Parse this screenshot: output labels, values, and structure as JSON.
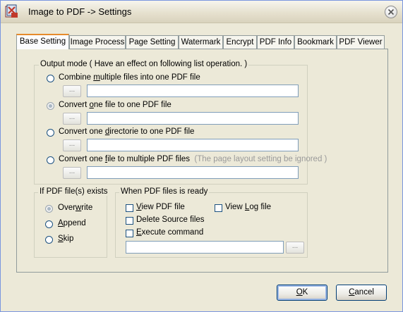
{
  "window": {
    "title": "Image to PDF -> Settings"
  },
  "tabs": [
    {
      "label": "Base Setting",
      "active": true
    },
    {
      "label": "Image Process"
    },
    {
      "label": "Page Setting"
    },
    {
      "label": "Watermark"
    },
    {
      "label": "Encrypt"
    },
    {
      "label": "PDF Info"
    },
    {
      "label": "Bookmark"
    },
    {
      "label": "PDF Viewer"
    }
  ],
  "output_mode": {
    "legend": "Output mode  ( Have an  effect on following list operation. )",
    "options": [
      {
        "pre": "Combine ",
        "key": "m",
        "post": "ultiple files into one PDF file",
        "checked": false,
        "path": ""
      },
      {
        "pre": "Convert ",
        "key": "o",
        "post": "ne file to one PDF file",
        "checked": true,
        "path": ""
      },
      {
        "pre": "Convert one ",
        "key": "d",
        "post": "irectorie to one PDF file",
        "checked": false,
        "path": ""
      },
      {
        "pre": "Convert one ",
        "key": "f",
        "post": "ile to multiple PDF files",
        "checked": false,
        "path": "",
        "hint": "(The page layout setting be ignored )"
      }
    ],
    "browse_label": "..."
  },
  "if_exists": {
    "legend": "If PDF file(s) exists",
    "options": [
      {
        "pre": "Over",
        "key": "w",
        "post": "rite",
        "checked": true
      },
      {
        "pre": "",
        "key": "A",
        "post": "ppend",
        "checked": false
      },
      {
        "pre": "",
        "key": "S",
        "post": "kip",
        "checked": false
      }
    ]
  },
  "when_ready": {
    "legend": "When PDF files is ready",
    "view_pdf": {
      "pre": "",
      "key": "V",
      "post": "iew PDF file"
    },
    "view_log": {
      "pre": "View ",
      "key": "L",
      "post": "og file"
    },
    "delete_source": {
      "label": "Delete Source files"
    },
    "execute": {
      "pre": "",
      "key": "E",
      "post": "xecute command"
    },
    "command": "",
    "browse_label": "..."
  },
  "buttons": {
    "ok": {
      "key": "O",
      "post": "K"
    },
    "cancel": {
      "key": "C",
      "post": "ancel"
    }
  }
}
